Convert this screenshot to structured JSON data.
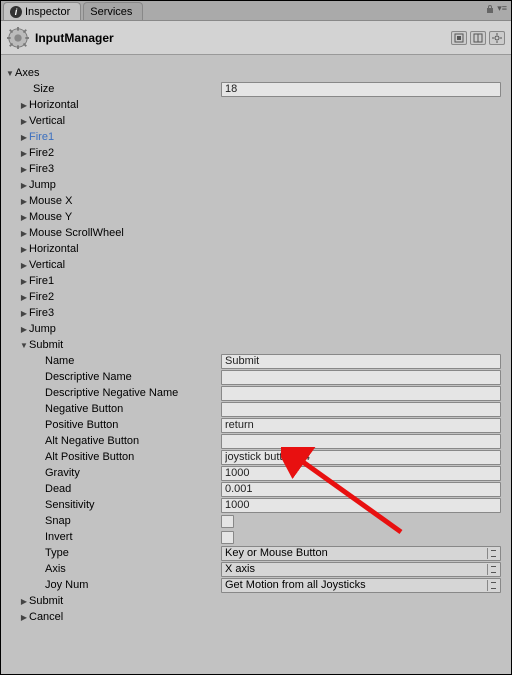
{
  "tabs": {
    "inspector": "Inspector",
    "services": "Services"
  },
  "header": {
    "title": "InputManager"
  },
  "axes": {
    "label": "Axes",
    "size_label": "Size",
    "size_value": "18",
    "items": [
      "Horizontal",
      "Vertical",
      "Fire1",
      "Fire2",
      "Fire3",
      "Jump",
      "Mouse X",
      "Mouse Y",
      "Mouse ScrollWheel",
      "Horizontal",
      "Vertical",
      "Fire1",
      "Fire2",
      "Fire3",
      "Jump",
      "Submit",
      "Submit",
      "Cancel"
    ],
    "selected_index": 2,
    "expanded_index": 15
  },
  "fields": {
    "name": {
      "label": "Name",
      "value": "Submit"
    },
    "desc_name": {
      "label": "Descriptive Name",
      "value": ""
    },
    "desc_neg": {
      "label": "Descriptive Negative Name",
      "value": ""
    },
    "neg_btn": {
      "label": "Negative Button",
      "value": ""
    },
    "pos_btn": {
      "label": "Positive Button",
      "value": "return"
    },
    "alt_neg": {
      "label": "Alt Negative Button",
      "value": ""
    },
    "alt_pos": {
      "label": "Alt Positive Button",
      "value": "joystick button 14"
    },
    "gravity": {
      "label": "Gravity",
      "value": "1000"
    },
    "dead": {
      "label": "Dead",
      "value": "0.001"
    },
    "sensitivity": {
      "label": "Sensitivity",
      "value": "1000"
    },
    "snap": {
      "label": "Snap",
      "checked": false
    },
    "invert": {
      "label": "Invert",
      "checked": false
    },
    "type": {
      "label": "Type",
      "value": "Key or Mouse Button"
    },
    "axis": {
      "label": "Axis",
      "value": "X axis"
    },
    "joynum": {
      "label": "Joy Num",
      "value": "Get Motion from all Joysticks"
    }
  }
}
